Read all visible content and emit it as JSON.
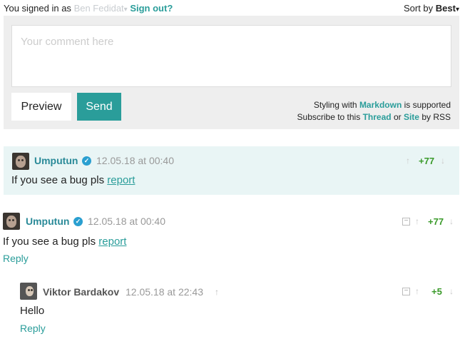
{
  "header": {
    "signed_prefix": "You signed in as",
    "user_name": "Ben Fedidat",
    "user_caret": "▾",
    "sign_out": "Sign out?",
    "sort_prefix": "Sort by",
    "sort_value": "Best",
    "sort_caret": "▾"
  },
  "composer": {
    "placeholder": "Your comment here",
    "preview_label": "Preview",
    "send_label": "Send",
    "styling_prefix": "Styling with",
    "styling_link": "Markdown",
    "styling_suffix": "is supported",
    "subscribe_prefix": "Subscribe to this",
    "thread_link": "Thread",
    "or_text": "or",
    "site_link": "Site",
    "rss_suffix": "by RSS"
  },
  "comments": [
    {
      "author": "Umputun",
      "time": "12.05.18 at 00:40",
      "body_prefix": "If you see a bug pls",
      "body_link": "report",
      "score": "+77",
      "up": "↑",
      "down": "↓"
    },
    {
      "author": "Umputun",
      "time": "12.05.18 at 00:40",
      "body_prefix": "If you see a bug pls",
      "body_link": "report",
      "score": "+77",
      "reply": "Reply",
      "collapse": "−",
      "up": "↑",
      "down": "↓"
    },
    {
      "author": "Viktor Bardakov",
      "time": "12.05.18 at 22:43",
      "pin": "↑",
      "body": "Hello",
      "score": "+5",
      "reply": "Reply",
      "collapse": "−",
      "up": "↑",
      "down": "↓"
    }
  ],
  "icons": {
    "verified": "✓"
  },
  "colors": {
    "accent": "#2a9d9a",
    "author": "#2a8a98",
    "score": "#3a9a2a",
    "highlight_bg": "#e9f5f5"
  }
}
